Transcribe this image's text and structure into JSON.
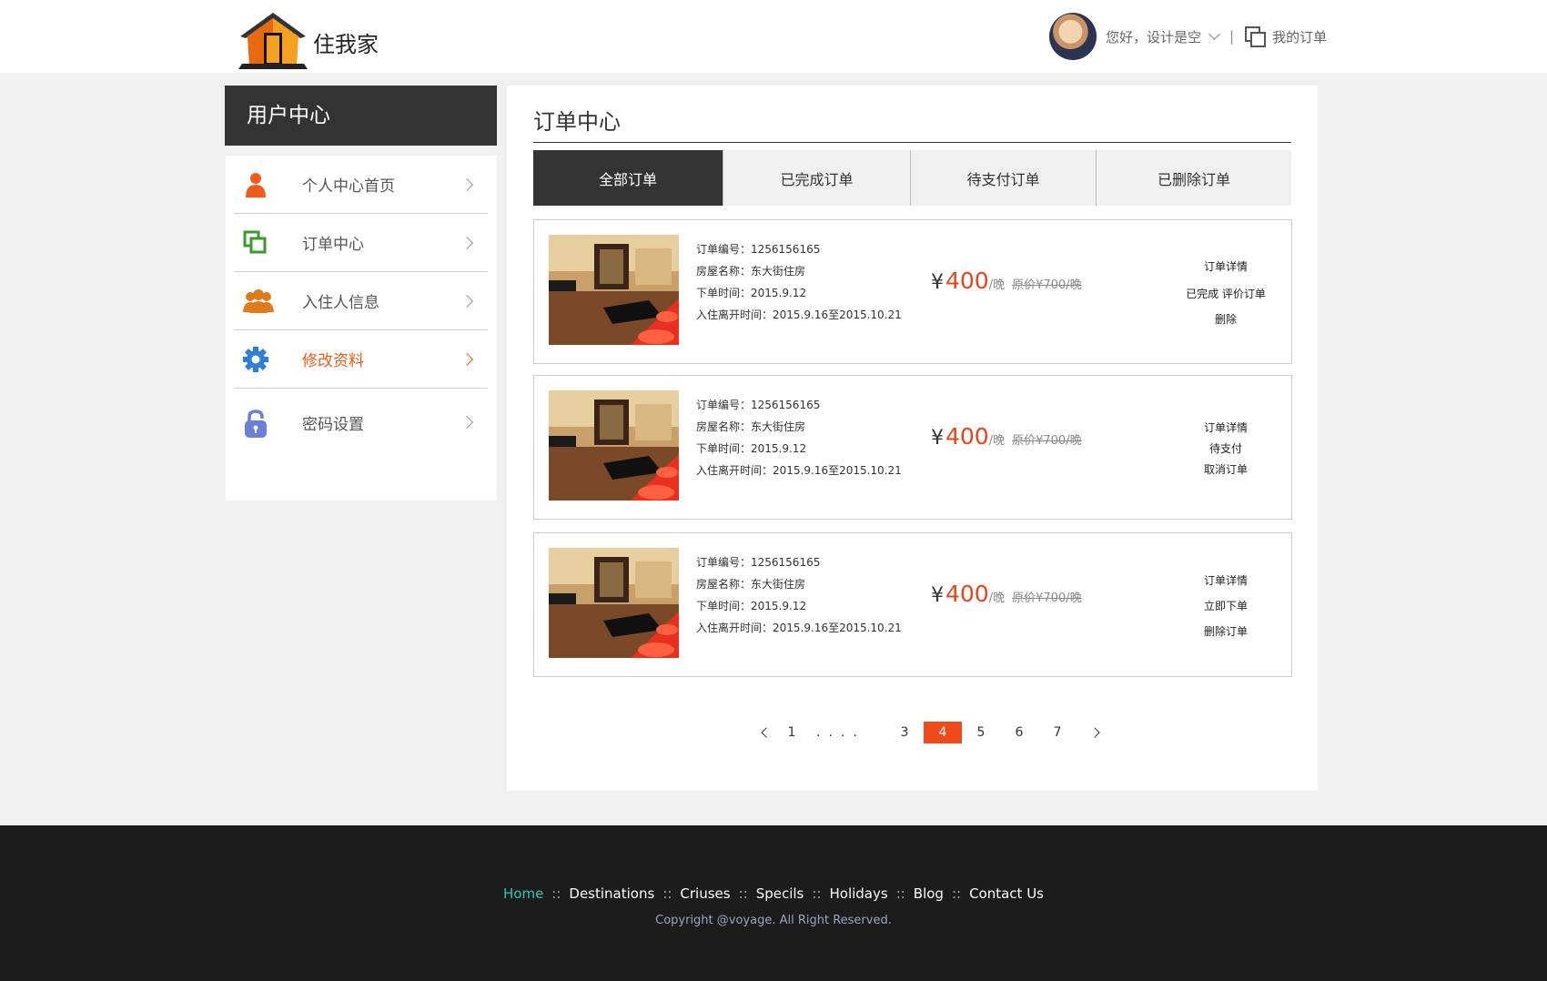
{
  "header": {
    "logo_text": "住我家",
    "greeting": "您好，设计是空",
    "separator": "|",
    "my_orders": "我的订单"
  },
  "sidebar": {
    "title": "用户中心",
    "items": [
      {
        "label": "个人中心首页",
        "icon": "person-icon",
        "color": "#f05a1a"
      },
      {
        "label": "订单中心",
        "icon": "orders-icon",
        "color": "#3a9a2e"
      },
      {
        "label": "入住人信息",
        "icon": "group-icon",
        "color": "#e07a1a"
      },
      {
        "label": "修改资料",
        "icon": "gear-icon",
        "color": "#2f7fd8",
        "active": true
      },
      {
        "label": "密码设置",
        "icon": "lock-icon",
        "color": "#6a7fd8"
      }
    ]
  },
  "main": {
    "title": "订单中心",
    "tabs": [
      "全部订单",
      "已完成订单",
      "待支付订单",
      "已删除订单"
    ],
    "active_tab": 0
  },
  "orders": [
    {
      "order_no": "订单编号：1256156165",
      "house_name": "房屋名称：东大街住房",
      "order_time": "下单时间：2015.9.12",
      "stay_time": "入住离开时间：2015.9.16至2015.10.21",
      "yen": "¥",
      "price": "400",
      "unit": "/晚",
      "original": "原价¥700/晚",
      "actions": [
        "订单详情",
        "已完成  评价订单",
        "删除"
      ]
    },
    {
      "order_no": "订单编号：1256156165",
      "house_name": "房屋名称：东大街住房",
      "order_time": "下单时间：2015.9.12",
      "stay_time": "入住离开时间：2015.9.16至2015.10.21",
      "yen": "¥",
      "price": "400",
      "unit": "/晚",
      "original": "原价¥700/晚",
      "actions": [
        "订单详情",
        "待支付",
        "取消订单"
      ]
    },
    {
      "order_no": "订单编号：1256156165",
      "house_name": "房屋名称：东大街住房",
      "order_time": "下单时间：2015.9.12",
      "stay_time": "入住离开时间：2015.9.16至2015.10.21",
      "yen": "¥",
      "price": "400",
      "unit": "/晚",
      "original": "原价¥700/晚",
      "actions": [
        "订单详情",
        "立即下单",
        "删除订单"
      ]
    }
  ],
  "pagination": {
    "pages": [
      "1",
      "....",
      "3",
      "4",
      "5",
      "6",
      "7"
    ],
    "current": "4"
  },
  "footer": {
    "links": [
      "Home",
      "Destinations",
      "Criuses",
      "Specils",
      "Holidays",
      "Blog",
      "Contact Us"
    ],
    "separator": "::",
    "copyright": "Copyright @voyage. All Right Reserved."
  },
  "colors": {
    "accent": "#f04a1a",
    "dark": "#333333",
    "footer_bg": "#1c1c1c",
    "footer_home": "#2ec4b6"
  }
}
